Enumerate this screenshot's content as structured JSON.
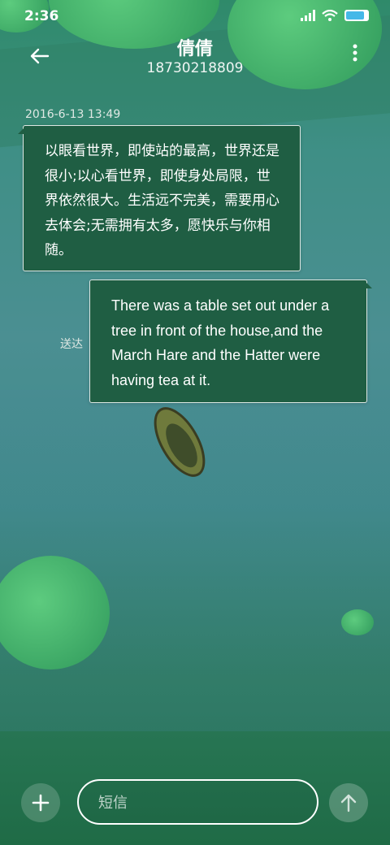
{
  "status_bar": {
    "time": "2:36"
  },
  "header": {
    "contact_name": "倩倩",
    "contact_number": "18730218809"
  },
  "messages": [
    {
      "direction": "incoming",
      "timestamp": "2016-6-13 13:49",
      "text": "以眼看世界，即使站的最高，世界还是很小;以心看世界，即使身处局限，世界依然很大。生活远不完美，需要用心去体会;无需拥有太多，愿快乐与你相随。"
    },
    {
      "direction": "outgoing",
      "status": "送达",
      "text": "There was a table set out under a tree in front of the house,and the March Hare and the Hatter were having tea at it."
    }
  ],
  "composer": {
    "placeholder": "短信"
  },
  "icons": {
    "back": "arrow-left-icon",
    "menu": "more-vertical-icon",
    "add": "plus-icon",
    "send": "arrow-up-icon"
  }
}
